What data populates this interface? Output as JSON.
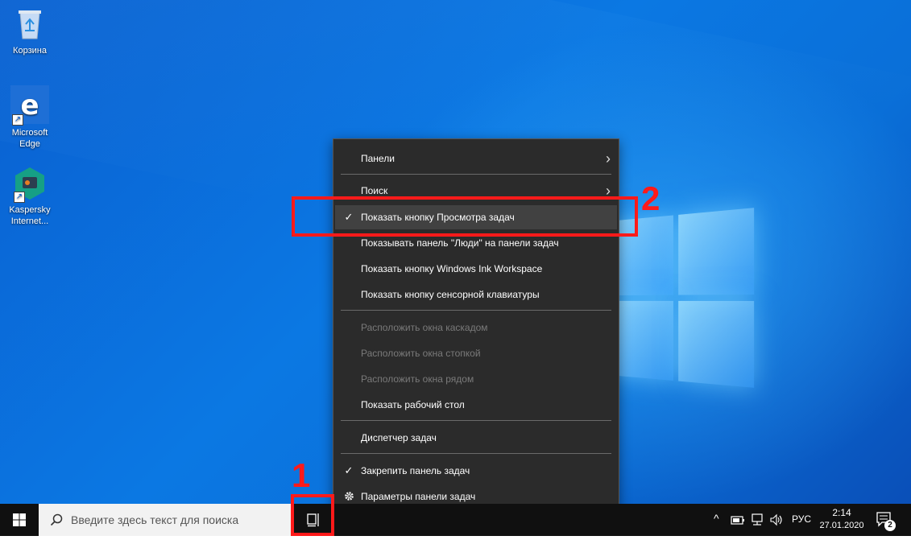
{
  "desktop": {
    "icons": [
      {
        "label": "Корзина",
        "icon": "recycle-bin-icon"
      },
      {
        "label": "Microsoft Edge",
        "icon": "edge-icon"
      },
      {
        "label": "Kaspersky Internet...",
        "icon": "kaspersky-icon"
      }
    ]
  },
  "context_menu": {
    "items": [
      {
        "label": "Панели",
        "submenu": true
      },
      {
        "label": "Поиск",
        "submenu": true
      },
      {
        "label": "Показать кнопку Просмотра задач",
        "checked": true,
        "highlighted": true
      },
      {
        "label": "Показывать панель \"Люди\" на панели задач"
      },
      {
        "label": "Показать кнопку Windows Ink Workspace"
      },
      {
        "label": "Показать кнопку сенсорной клавиатуры"
      },
      {
        "label": "Расположить окна каскадом",
        "disabled": true
      },
      {
        "label": "Расположить окна стопкой",
        "disabled": true
      },
      {
        "label": "Расположить окна рядом",
        "disabled": true
      },
      {
        "label": "Показать рабочий стол"
      },
      {
        "label": "Диспетчер задач"
      },
      {
        "label": "Закрепить панель задач",
        "checked": true
      },
      {
        "label": "Параметры панели задач",
        "icon": "gear-icon"
      }
    ],
    "check_glyph": "✓",
    "arrow_glyph": "›"
  },
  "taskbar": {
    "search_placeholder": "Введите здесь текст для поиска",
    "tray": {
      "language": "РУС",
      "time": "2:14",
      "date": "27.01.2020",
      "notification_count": "2"
    }
  },
  "annotations": {
    "marker_1": "1",
    "marker_2": "2",
    "color": "#ff1a1a"
  }
}
